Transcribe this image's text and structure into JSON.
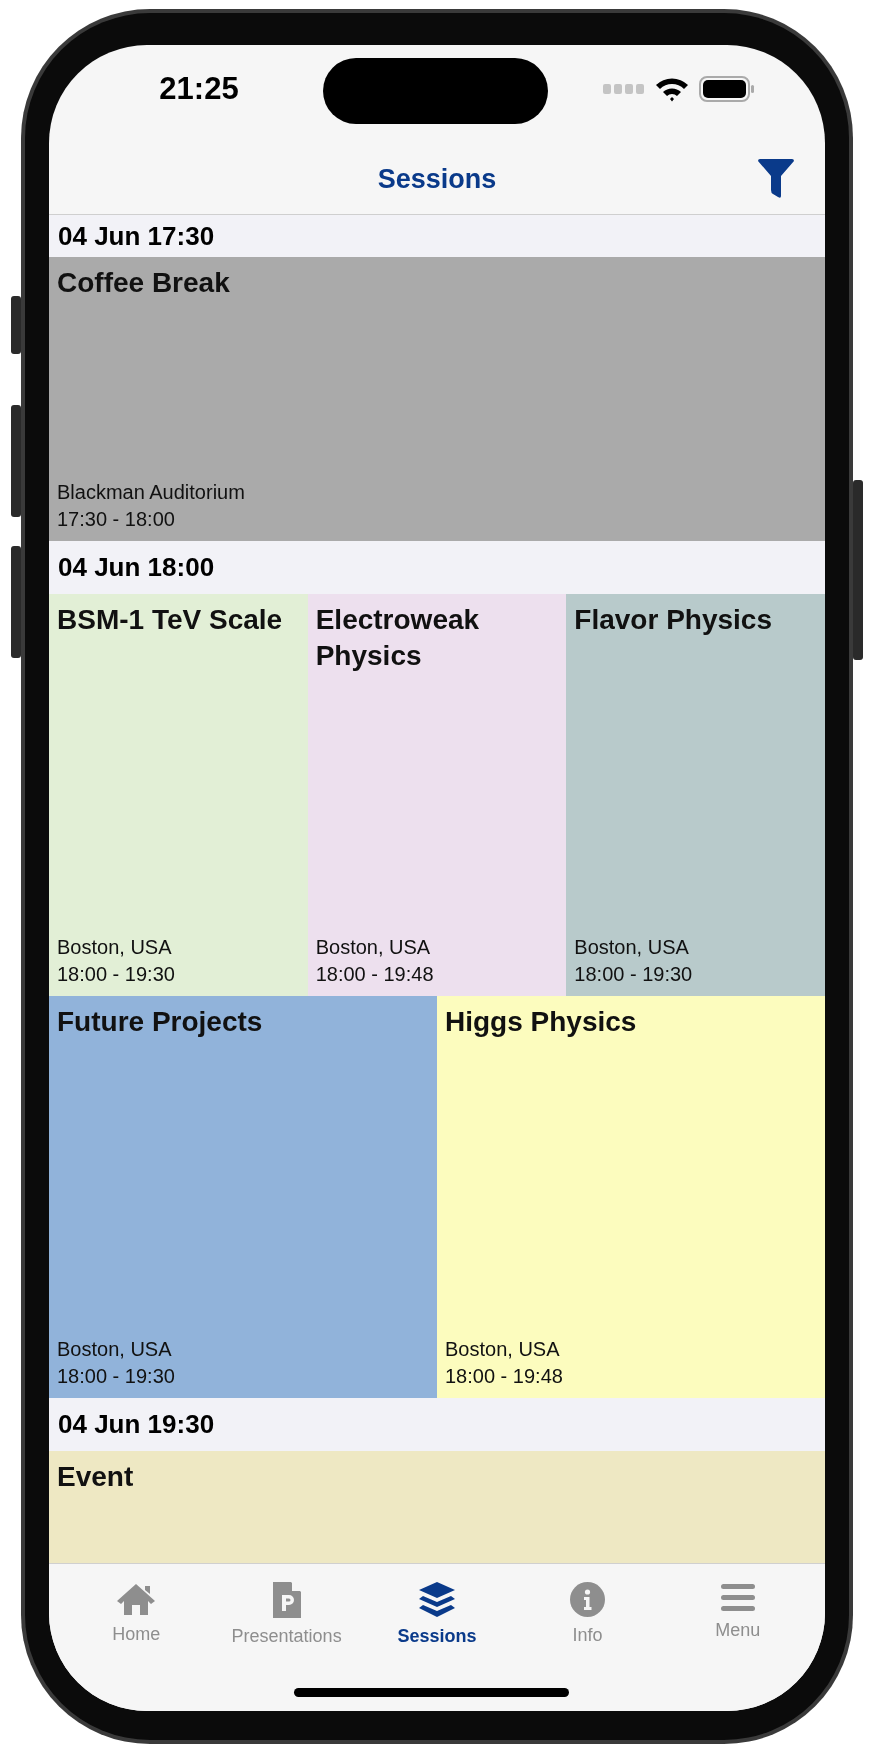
{
  "status_bar": {
    "time": "21:25"
  },
  "nav_bar": {
    "title": "Sessions"
  },
  "sections": [
    {
      "header": "04 Jun 17:30",
      "rows": [
        [
          {
            "title": "Coffee Break",
            "location": "Blackman Auditorium",
            "time": "17:30 - 18:00",
            "color": "#aaaaaa"
          }
        ]
      ]
    },
    {
      "header": "04 Jun 18:00",
      "rows": [
        [
          {
            "title": "BSM-1 TeV Scale",
            "location": "Boston, USA",
            "time": "18:00 - 19:30",
            "color": "#e2efd6"
          },
          {
            "title": "Electroweak Physics",
            "location": "Boston, USA",
            "time": "18:00 - 19:48",
            "color": "#ede0ee"
          },
          {
            "title": "Flavor Physics",
            "location": "Boston, USA",
            "time": "18:00 - 19:30",
            "color": "#b8cacb"
          }
        ],
        [
          {
            "title": "Future Projects",
            "location": "Boston, USA",
            "time": "18:00 - 19:30",
            "color": "#91b3da"
          },
          {
            "title": "Higgs Physics",
            "location": "Boston, USA",
            "time": "18:00 - 19:48",
            "color": "#fcfcbe"
          }
        ]
      ]
    },
    {
      "header": "04 Jun 19:30",
      "rows": [
        [
          {
            "title": "Event",
            "color": "#eee8c3"
          }
        ]
      ]
    }
  ],
  "tab_bar": [
    {
      "kind": "home",
      "label": "Home",
      "selected": false
    },
    {
      "kind": "presentations",
      "label": "Presentations",
      "selected": false
    },
    {
      "kind": "sessions",
      "label": "Sessions",
      "selected": true
    },
    {
      "kind": "info",
      "label": "Info",
      "selected": false
    },
    {
      "kind": "menu",
      "label": "Menu",
      "selected": false
    }
  ]
}
